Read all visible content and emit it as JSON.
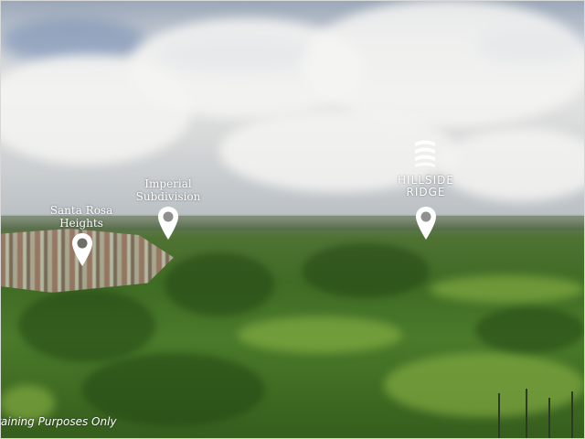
{
  "markers": [
    {
      "id": "santa-rosa",
      "label_line1": "Santa Rosa",
      "label_line2": "Heights"
    },
    {
      "id": "imperial",
      "label_line1": "Imperial",
      "label_line2": "Subdivision"
    },
    {
      "id": "hillside",
      "label_line1": "HILLSIDE",
      "label_line2": "RIDGE"
    }
  ],
  "watermark": "raining Purposes Only",
  "colors": {
    "pin": "#ffffff",
    "sky": "#dcdedd",
    "vegetation": "#3f6b24"
  },
  "icons": {
    "pin": "map-pin-icon",
    "logo": "hillside-ridge-logo"
  }
}
